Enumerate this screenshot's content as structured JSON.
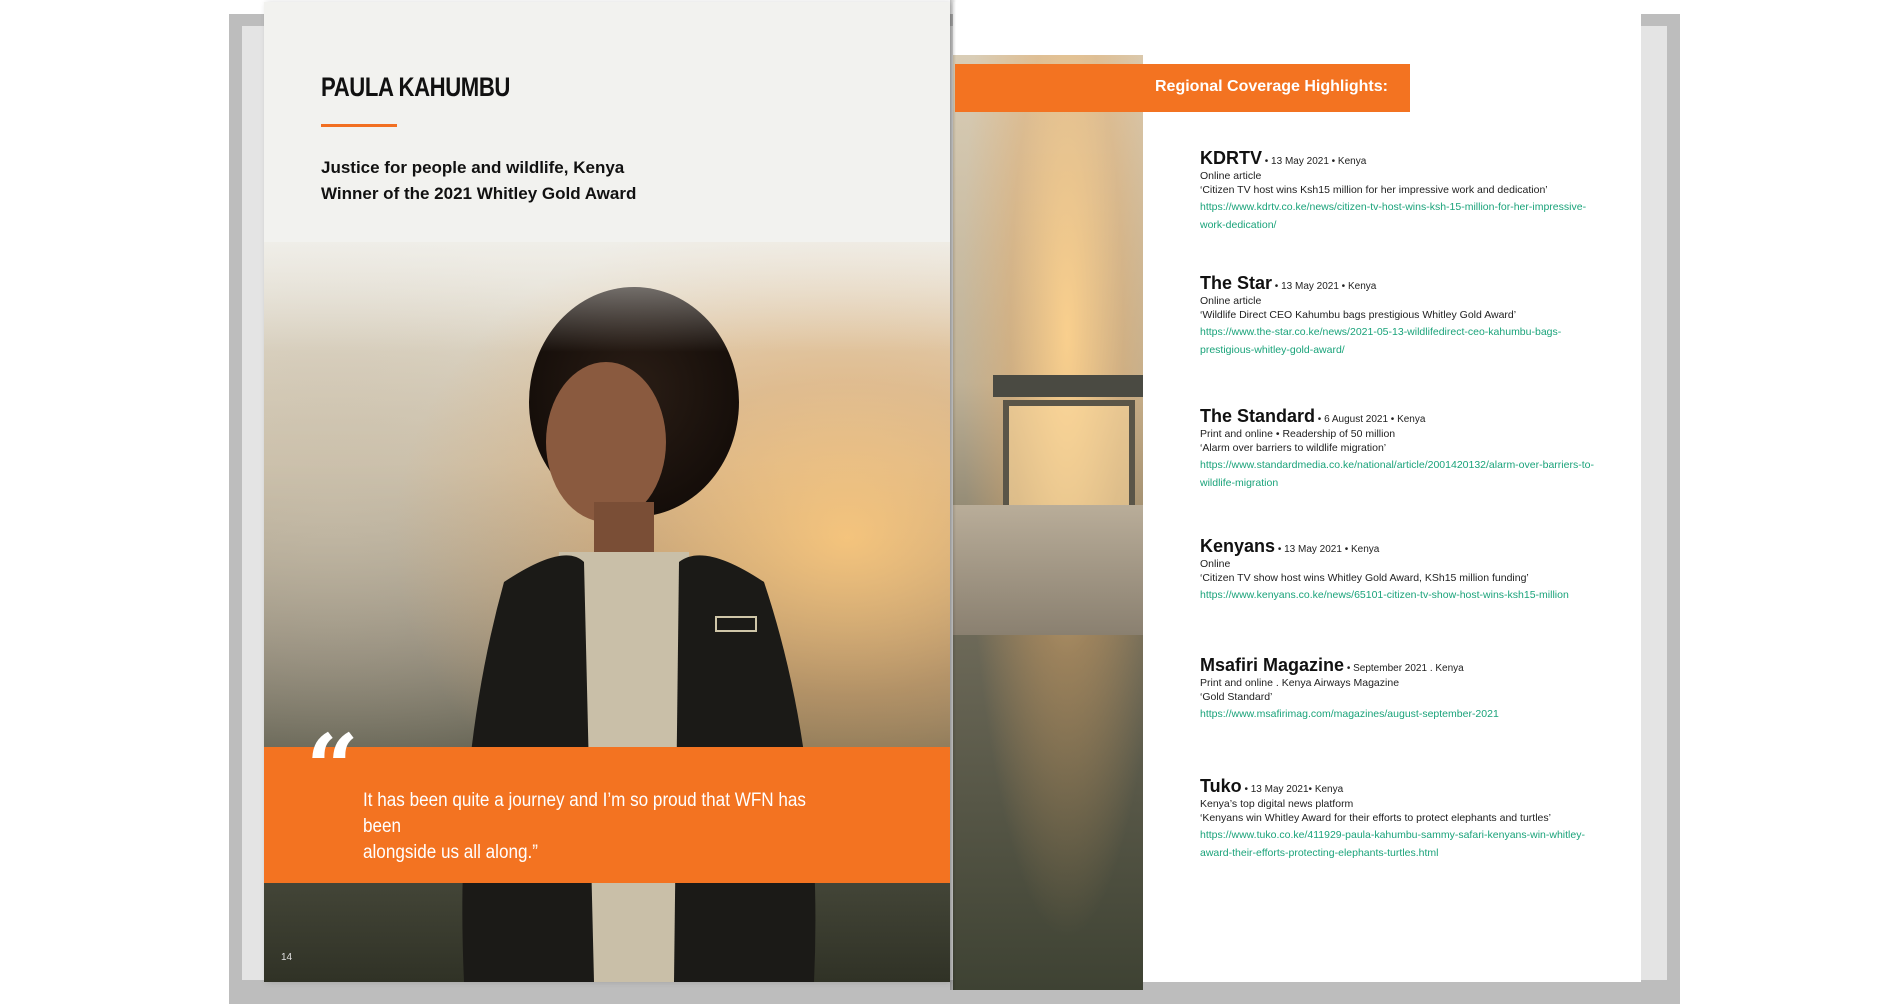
{
  "left_page": {
    "title": "PAULA KAHUMBU",
    "subtitle_line1": "Justice for people and wildlife, Kenya",
    "subtitle_line2": "Winner of the 2021 Whitley Gold Award",
    "quote_mark": "“",
    "quote_line1": "It has been quite a journey and I’m so proud that WFN has been",
    "quote_line2": "alongside us all along.”",
    "page_number": "14"
  },
  "right_page": {
    "header": "Regional Coverage Highlights:",
    "entries": [
      {
        "source": "KDRTV",
        "meta": " • 13 May 2021  • Kenya",
        "type": "Online article",
        "headline": "‘Citizen TV host wins Ksh15 million for her impressive work and dedication’",
        "url1": "https://www.kdrtv.co.ke/news/citizen-tv-host-wins-ksh-15-million-for-her-impressive-",
        "url2": "work-dedication/"
      },
      {
        "source": "The Star",
        "meta": " • 13 May 2021  • Kenya",
        "type": "Online article",
        "headline": "‘Wildlife Direct CEO Kahumbu bags prestigious Whitley Gold Award’",
        "url1": "https://www.the-star.co.ke/news/2021-05-13-wildlifedirect-ceo-kahumbu-bags-",
        "url2": "prestigious-whitley-gold-award/"
      },
      {
        "source": "The Standard",
        "meta": "  • 6 August 2021 • Kenya",
        "type": "Print and online • Readership of 50 million",
        "headline": "‘Alarm over barriers to wildlife migration’",
        "url1": "https://www.standardmedia.co.ke/national/article/2001420132/alarm-over-barriers-to-",
        "url2": "wildlife-migration"
      },
      {
        "source": "Kenyans",
        "meta": " • 13 May 2021  •  Kenya",
        "type": "Online",
        "headline": "‘Citizen TV show host wins Whitley Gold Award, KSh15 million funding’",
        "url1": "https://www.kenyans.co.ke/news/65101-citizen-tv-show-host-wins-ksh15-million",
        "url2": ""
      },
      {
        "source": "Msafiri Magazine",
        "meta": " • September 2021 . Kenya",
        "type": "Print and online . Kenya Airways Magazine",
        "headline": "‘Gold Standard’",
        "url1": "https://www.msafirimag.com/magazines/august-september-2021",
        "url2": ""
      },
      {
        "source": "Tuko",
        "meta": " • 13 May 2021• Kenya",
        "type": "Kenya’s top digital news platform",
        "headline": "‘Kenyans win Whitley Award for their efforts to protect elephants and turtles’",
        "url1": "https://www.tuko.co.ke/411929-paula-kahumbu-sammy-safari-kenyans-win-whitley-",
        "url2": "award-their-efforts-protecting-elephants-turtles.html"
      }
    ]
  },
  "colors": {
    "accent_orange": "#f37321",
    "link_green": "#1aa37a"
  }
}
